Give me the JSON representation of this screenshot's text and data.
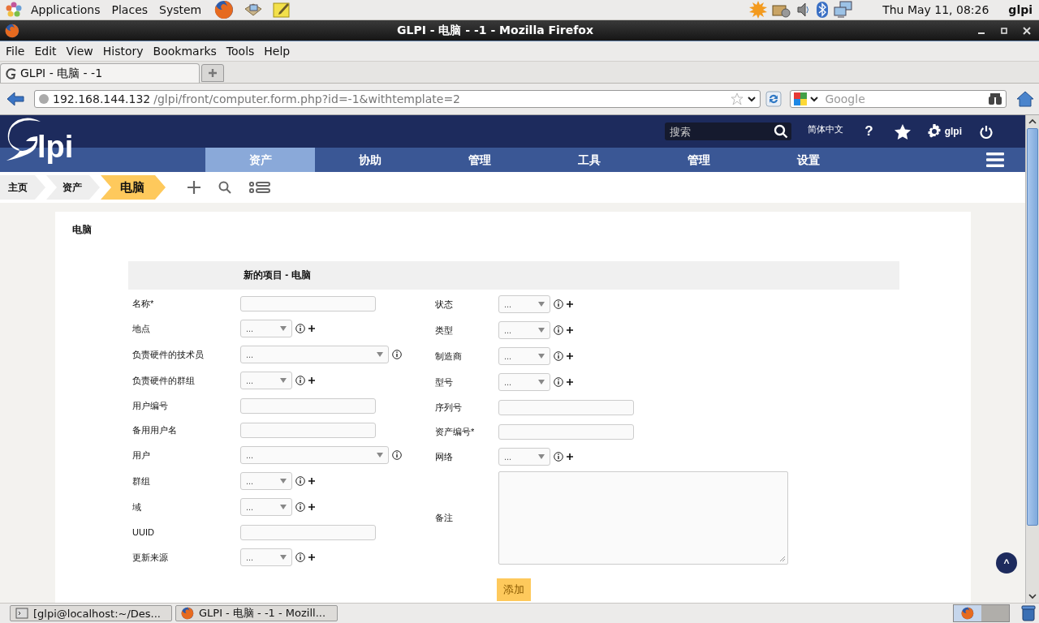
{
  "desktop_panel": {
    "menus": [
      "Applications",
      "Places",
      "System"
    ],
    "clock": "Thu May 11, 08:26",
    "user": "glpi"
  },
  "window": {
    "title": "GLPI - 电脑 - -1 - Mozilla Firefox"
  },
  "menu_bar": [
    "File",
    "Edit",
    "View",
    "History",
    "Bookmarks",
    "Tools",
    "Help"
  ],
  "tabs": [
    {
      "label": "GLPI - 电脑 - -1",
      "selected": true
    }
  ],
  "address_bar": {
    "host": "192.168.144.132",
    "path": "/glpi/front/computer.form.php?id=-1&withtemplate=2"
  },
  "web_search": {
    "placeholder": "Google"
  },
  "glpi": {
    "logo": "lpi",
    "search_placeholder": "搜索",
    "language": "简体中文",
    "help": "?",
    "user": "glpi",
    "menu": [
      {
        "label": "资产",
        "selected": true
      },
      {
        "label": "协助",
        "selected": false
      },
      {
        "label": "管理",
        "selected": false
      },
      {
        "label": "工具",
        "selected": false
      },
      {
        "label": "管理",
        "selected": false
      },
      {
        "label": "设置",
        "selected": false
      }
    ],
    "breadcrumb": [
      {
        "label": "主页",
        "current": false
      },
      {
        "label": "资产",
        "current": false
      },
      {
        "label": "电脑",
        "current": true
      }
    ]
  },
  "form": {
    "panel_title": "电脑",
    "header": "新的项目 - 电脑",
    "left": [
      {
        "label": "名称*",
        "kind": "text"
      },
      {
        "label": "地点",
        "kind": "select",
        "value": "...",
        "add": true
      },
      {
        "label": "负责硬件的技术员",
        "kind": "select_wide",
        "value": "...",
        "add": false
      },
      {
        "label": "负责硬件的群组",
        "kind": "select",
        "value": "...",
        "add": true
      },
      {
        "label": "用户编号",
        "kind": "text"
      },
      {
        "label": "备用用户名",
        "kind": "text"
      },
      {
        "label": "用户",
        "kind": "select_wide",
        "value": "...",
        "add": false
      },
      {
        "label": "群组",
        "kind": "select",
        "value": "...",
        "add": true
      },
      {
        "label": "域",
        "kind": "select",
        "value": "...",
        "add": true
      },
      {
        "label": "UUID",
        "kind": "text"
      },
      {
        "label": "更新来源",
        "kind": "select",
        "value": "...",
        "add": true
      }
    ],
    "right": [
      {
        "label": "状态",
        "kind": "select",
        "value": "...",
        "add": true
      },
      {
        "label": "类型",
        "kind": "select",
        "value": "...",
        "add": true
      },
      {
        "label": "制造商",
        "kind": "select",
        "value": "...",
        "add": true
      },
      {
        "label": "型号",
        "kind": "select",
        "value": "...",
        "add": true
      },
      {
        "label": "序列号",
        "kind": "text"
      },
      {
        "label": "资产编号*",
        "kind": "text"
      },
      {
        "label": "网络",
        "kind": "select",
        "value": "...",
        "add": true
      },
      {
        "label": "备注",
        "kind": "textarea"
      }
    ],
    "submit": "添加"
  },
  "back_to_top": "^",
  "taskbar": [
    {
      "label": "[glpi@localhost:~/Des...",
      "kind": "terminal"
    },
    {
      "label": "GLPI - 电脑 - -1 - Mozill...",
      "kind": "browser"
    }
  ]
}
